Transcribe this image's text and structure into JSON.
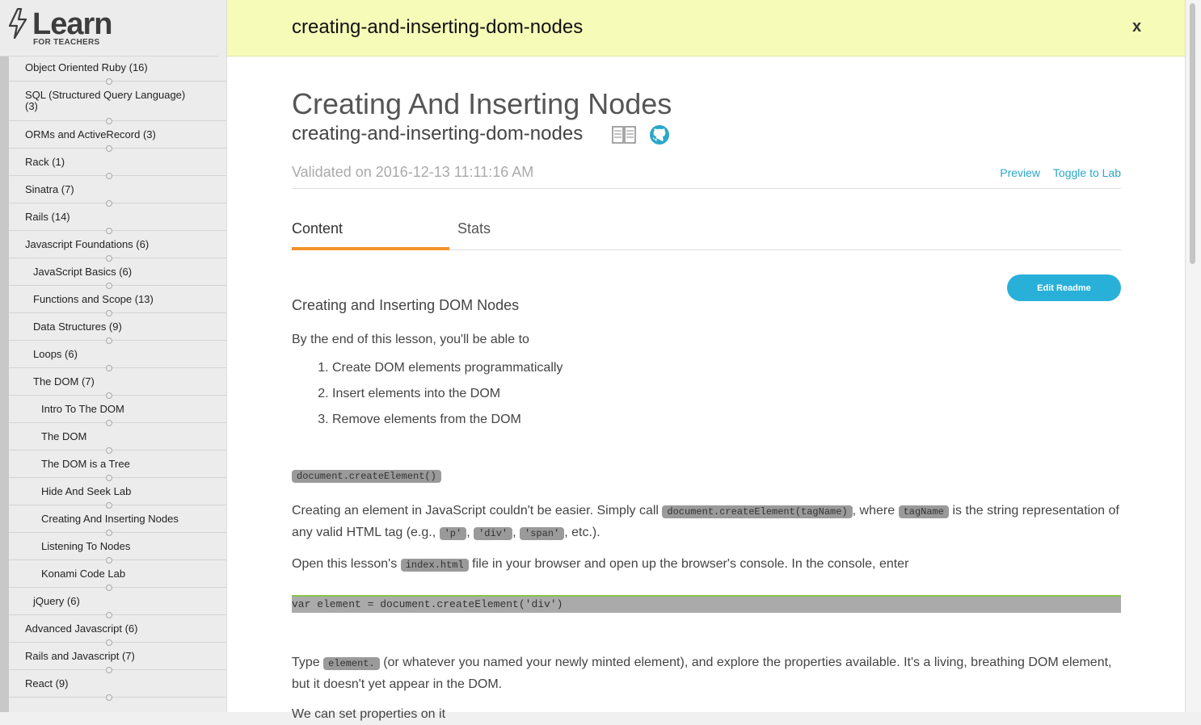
{
  "logo": {
    "word": "Learn",
    "sub": "FOR TEACHERS"
  },
  "sidebar": {
    "items": [
      {
        "label": "Object Oriented Ruby (16)",
        "indent": 0
      },
      {
        "label": "SQL (Structured Query Language) (3)",
        "indent": 0,
        "tall": true
      },
      {
        "label": "ORMs and ActiveRecord (3)",
        "indent": 0
      },
      {
        "label": "Rack (1)",
        "indent": 0
      },
      {
        "label": "Sinatra (7)",
        "indent": 0
      },
      {
        "label": "Rails (14)",
        "indent": 0
      },
      {
        "label": "Javascript Foundations (6)",
        "indent": 0
      },
      {
        "label": "JavaScript Basics (6)",
        "indent": 1
      },
      {
        "label": "Functions and Scope (13)",
        "indent": 1
      },
      {
        "label": "Data Structures (9)",
        "indent": 1
      },
      {
        "label": "Loops (6)",
        "indent": 1
      },
      {
        "label": "The DOM (7)",
        "indent": 1
      },
      {
        "label": "Intro To The DOM",
        "indent": 2
      },
      {
        "label": "The DOM",
        "indent": 2
      },
      {
        "label": "The DOM is a Tree",
        "indent": 2
      },
      {
        "label": "Hide And Seek Lab",
        "indent": 2
      },
      {
        "label": "Creating And Inserting Nodes",
        "indent": 2
      },
      {
        "label": "Listening To Nodes",
        "indent": 2
      },
      {
        "label": "Konami Code Lab",
        "indent": 2
      },
      {
        "label": "jQuery (6)",
        "indent": 1
      },
      {
        "label": "Advanced Javascript (6)",
        "indent": 0
      },
      {
        "label": "Rails and Javascript (7)",
        "indent": 0
      },
      {
        "label": "React (9)",
        "indent": 0
      }
    ]
  },
  "header": {
    "title": "creating-and-inserting-dom-nodes",
    "close": "x"
  },
  "lesson": {
    "title": "Creating And Inserting Nodes",
    "slug": "creating-and-inserting-dom-nodes",
    "validated": "Validated on 2016-12-13 11:11:16 AM",
    "preview": "Preview",
    "toggle": "Toggle to Lab"
  },
  "tabs": {
    "content": "Content",
    "stats": "Stats"
  },
  "edit_button": "Edit Readme",
  "readme": {
    "heading": "Creating and Inserting DOM Nodes",
    "intro": "By the end of this lesson, you'll be able to",
    "goals": [
      "Create DOM elements programmatically",
      "Insert elements into the DOM",
      "Remove elements from the DOM"
    ],
    "code_heading": "document.createElement()",
    "p1_a": "Creating an element in JavaScript couldn't be easier. Simply call ",
    "p1_code1": "document.createElement(tagName)",
    "p1_b": ", where ",
    "p1_code2": "tagName",
    "p1_c": " is the string representation of any valid HTML tag (e.g., ",
    "p1_code3": "'p'",
    "p1_sep1": ", ",
    "p1_code4": "'div'",
    "p1_sep2": ", ",
    "p1_code5": "'span'",
    "p1_d": ", etc.).",
    "p2_a": "Open this lesson's ",
    "p2_code": "index.html",
    "p2_b": " file in your browser and open up the browser's console. In the console, enter",
    "codeblock": "var element = document.createElement('div')",
    "p3_a": "Type ",
    "p3_code": "element.",
    "p3_b": " (or whatever you named your newly minted element), and explore the properties available. It's a living, breathing DOM element, but it doesn't yet appear in the DOM.",
    "p4": "We can set properties on it"
  },
  "colors": {
    "header_bg": "#f6fbb8",
    "accent": "#29b0d9",
    "tab_underline": "#f0922c"
  }
}
